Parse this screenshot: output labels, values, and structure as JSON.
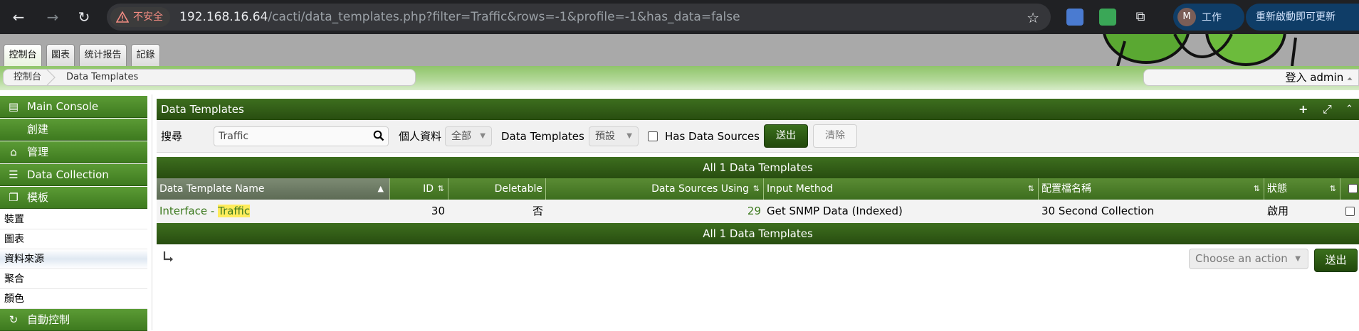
{
  "browser": {
    "security_label": "不安全",
    "url_host": "192.168.16.64",
    "url_path": "/cacti/data_templates.php?filter=Traffic&rows=-1&profile=-1&has_data=false",
    "profile_initial": "M",
    "profile_name": "工作",
    "update_label": "重新啟動即可更新"
  },
  "top_tabs": [
    "控制台",
    "圖表",
    "统计报告",
    "記錄"
  ],
  "breadcrumb": {
    "root": "控制台",
    "current": "Data Templates"
  },
  "login": {
    "text": "登入 admin",
    "caret": "⏶"
  },
  "sidebar": {
    "main_console": "Main Console",
    "create": "創建",
    "manage": "管理",
    "data_collection": "Data Collection",
    "templates": "模板",
    "template_items": [
      "裝置",
      "圖表",
      "資料來源",
      "聚合",
      "顏色"
    ],
    "automation": "自動控制"
  },
  "panel": {
    "title": "Data Templates",
    "filter": {
      "search_label": "搜尋",
      "search_value": "Traffic",
      "profile_label": "個人資料",
      "profile_value": "全部",
      "templates_label": "Data Templates",
      "templates_value": "預設",
      "has_data_label": "Has Data Sources",
      "go_label": "送出",
      "clear_label": "清除"
    },
    "nav_text": "All 1 Data Templates",
    "columns": [
      "Data Template Name",
      "ID",
      "Deletable",
      "Data Sources Using",
      "Input Method",
      "配置檔名稱",
      "狀態"
    ],
    "rows": [
      {
        "name_prefix": "Interface - ",
        "name_highlight": "Traffic",
        "id": "30",
        "deletable": "否",
        "data_sources_using": "29",
        "input_method": "Get SNMP Data (Indexed)",
        "profile": "30 Second Collection",
        "status": "啟用"
      }
    ],
    "action_placeholder": "Choose an action",
    "submit_label": "送出"
  },
  "colors": {
    "cacti_green_dark": "#284d10",
    "cacti_green": "#3d6e1e",
    "link_green": "#3d7a1f",
    "highlight": "#ffec5c"
  }
}
